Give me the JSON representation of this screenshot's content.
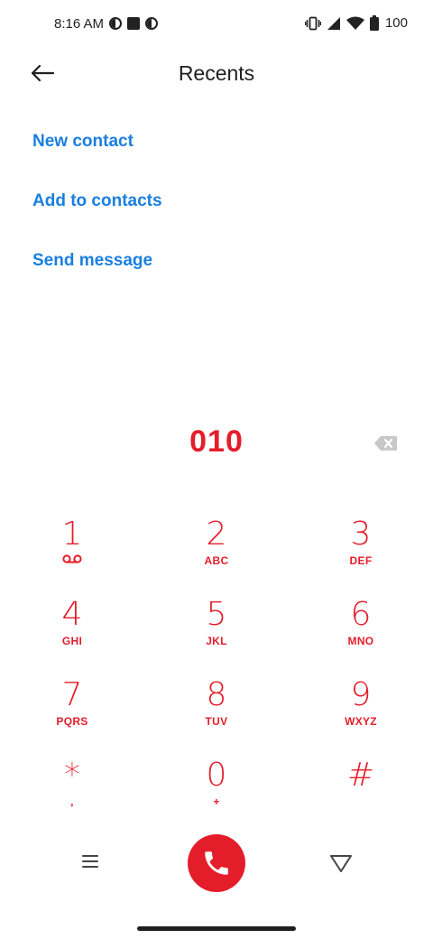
{
  "status_bar": {
    "time": "8:16 AM",
    "battery": "100"
  },
  "header": {
    "title": "Recents"
  },
  "actions": {
    "new_contact": "New contact",
    "add_to_contacts": "Add to contacts",
    "send_message": "Send message"
  },
  "dialer": {
    "number": "010"
  },
  "keypad": [
    {
      "digit": "1",
      "letters": ""
    },
    {
      "digit": "2",
      "letters": "ABC"
    },
    {
      "digit": "3",
      "letters": "DEF"
    },
    {
      "digit": "4",
      "letters": "GHI"
    },
    {
      "digit": "5",
      "letters": "JKL"
    },
    {
      "digit": "6",
      "letters": "MNO"
    },
    {
      "digit": "7",
      "letters": "PQRS"
    },
    {
      "digit": "8",
      "letters": "TUV"
    },
    {
      "digit": "9",
      "letters": "WXYZ"
    },
    {
      "digit": "*",
      "letters": ","
    },
    {
      "digit": "0",
      "letters": "+"
    },
    {
      "digit": "#",
      "letters": ""
    }
  ],
  "colors": {
    "accent_red": "#e41d2b",
    "link_blue": "#1a7fe0"
  }
}
